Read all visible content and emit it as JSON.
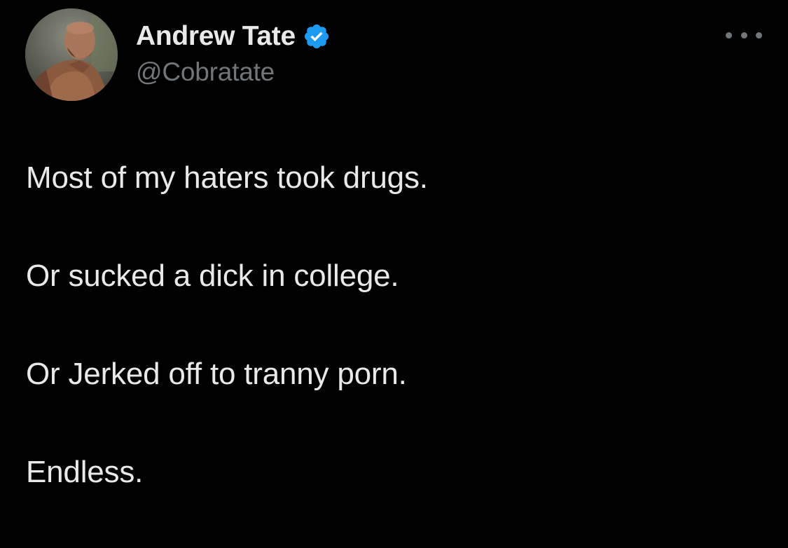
{
  "tweet": {
    "author": {
      "display_name": "Andrew Tate",
      "handle": "@Cobratate",
      "verified": true
    },
    "paragraphs": [
      "Most of my haters took drugs.",
      "Or sucked a dick in college.",
      "Or Jerked off to tranny porn.",
      "Endless."
    ]
  },
  "icons": {
    "verified": "verified-badge-icon",
    "more": "more-options-icon"
  },
  "colors": {
    "background": "#000000",
    "primary_text": "#e7e9ea",
    "secondary_text": "#71767b",
    "verified_blue": "#1d9bf0"
  }
}
